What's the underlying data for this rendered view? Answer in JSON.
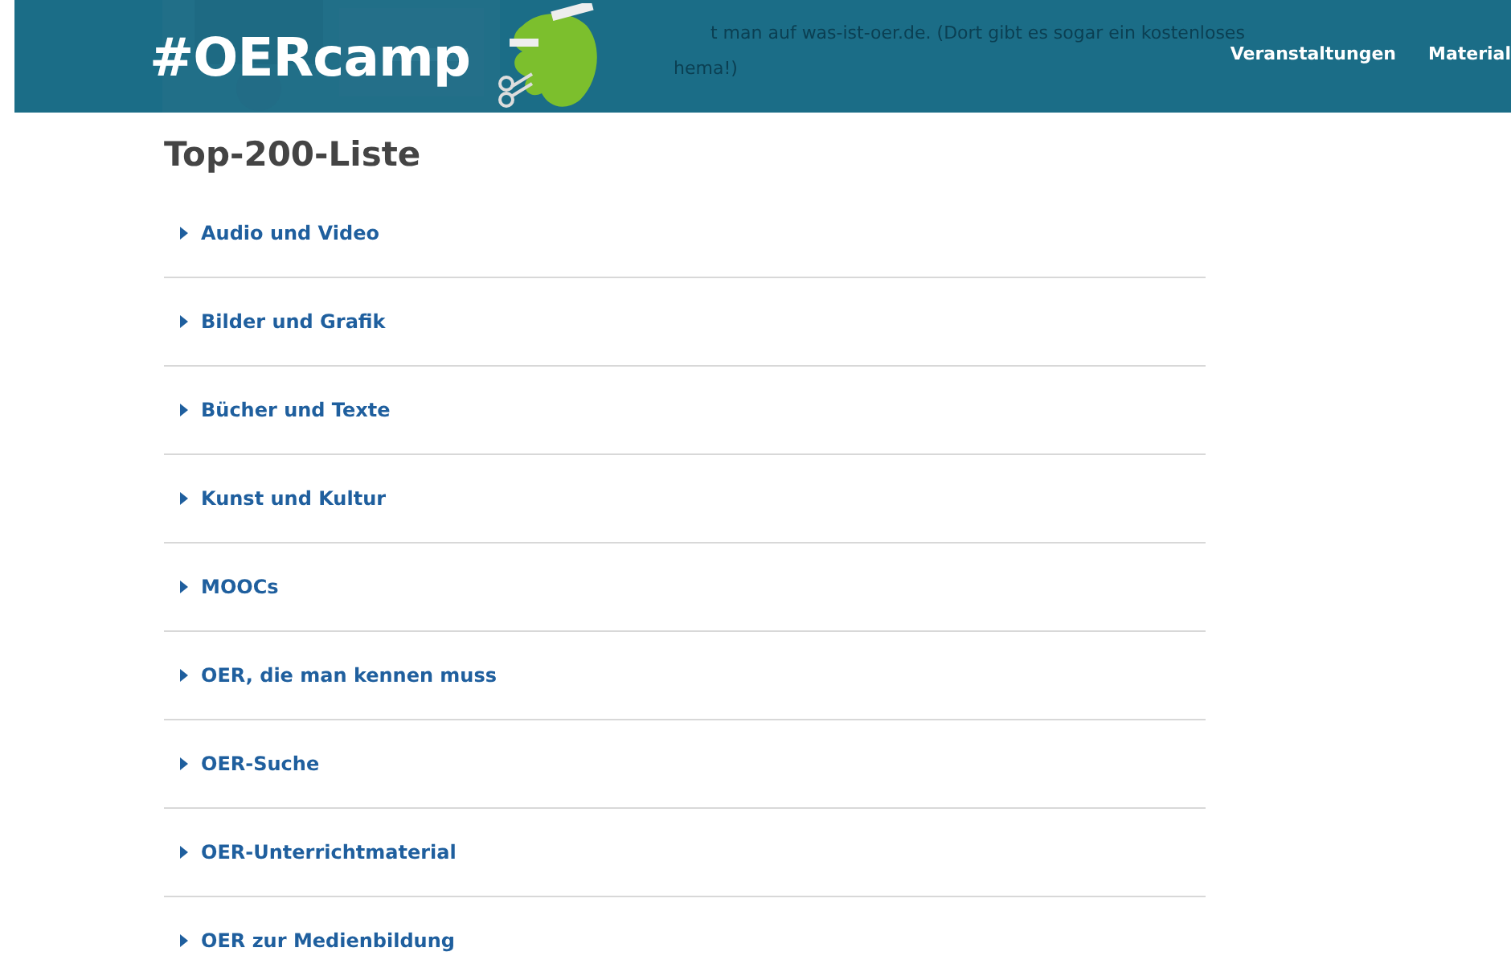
{
  "header": {
    "logo": "#OERcamp",
    "background_text": [
      "t man auf was-ist-oer.de. (Dort gibt es sogar ein kostenloses",
      "hema!)"
    ],
    "nav": [
      "Veranstaltungen",
      "Material"
    ]
  },
  "title": "Top-200-Liste",
  "sections": [
    {
      "label": "Audio und Video",
      "expanded": false
    },
    {
      "label": "Bilder und Grafik",
      "expanded": false
    },
    {
      "label": "Bücher und Texte",
      "expanded": false
    },
    {
      "label": "Kunst und Kultur",
      "expanded": false
    },
    {
      "label": "MOOCs",
      "expanded": false
    },
    {
      "label": "OER, die man kennen muss",
      "expanded": false
    },
    {
      "label": "OER-Suche",
      "expanded": false
    },
    {
      "label": "OER-Unterrichtmaterial",
      "expanded": false
    },
    {
      "label": "OER zur Medienbildung",
      "expanded": false
    }
  ]
}
